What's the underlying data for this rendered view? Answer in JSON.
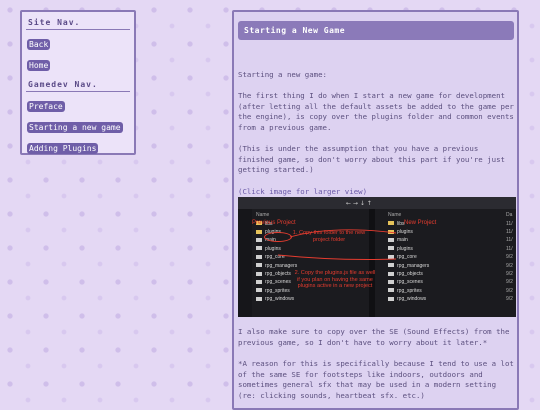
{
  "sidebar": {
    "site_heading": "Site Nav.",
    "site_links": [
      "Back",
      "Home"
    ],
    "gamedev_heading": "Gamedev Nav.",
    "gamedev_links": [
      "Preface",
      "Starting a new game",
      "Adding Plugins"
    ]
  },
  "main": {
    "title": "Starting a New Game",
    "intro": "Starting a new game:",
    "p1": "The first thing I do when I start a new game for development (after letting all the default assets be added to the game per the engine), is copy over the plugins folder and common events from a previous game.",
    "p2": "(This is under the assumption that you have a previous finished game, so don't worry about this part if you're just getting started.)",
    "image_link": "(Click image for larger view)",
    "p3": "I also make sure to copy over the SE (Sound Effects) from the previous game, so I don't have to worry about it later.*",
    "p4": "*A reason for this is specifically because I tend to use a lot of the same SE for footsteps like indoors, outdoors and sometimes general sfx that may be used in a modern setting (re: clicking sounds, heartbeat sfx. etc.)"
  },
  "screenshot": {
    "label_previous": "Previous Project",
    "label_new": "New Project",
    "annotation_1": "1. Copy this folder to the new project folder",
    "annotation_2": "2. Copy the plugins.js file as well if you plan on having the same plugins active in a new project",
    "column_header": "Name",
    "left_files": [
      "libs",
      "plugins",
      "main",
      "plugins",
      "rpg_core",
      "rpg_managers",
      "rpg_objects",
      "rpg_scenes",
      "rpg_sprites",
      "rpg_windows"
    ],
    "right_files": [
      "libs",
      "plugins",
      "main",
      "plugins",
      "rpg_core",
      "rpg_managers",
      "rpg_objects",
      "rpg_scenes",
      "rpg_sprites",
      "rpg_windows"
    ],
    "right_trunc_header": "Da",
    "right_trunc_values": [
      "11/",
      "11/",
      "11/",
      "11/",
      "9/2",
      "9/2",
      "9/2",
      "9/2",
      "9/2",
      "9/2"
    ],
    "path_glyphs": "← → ↓ ↑"
  }
}
